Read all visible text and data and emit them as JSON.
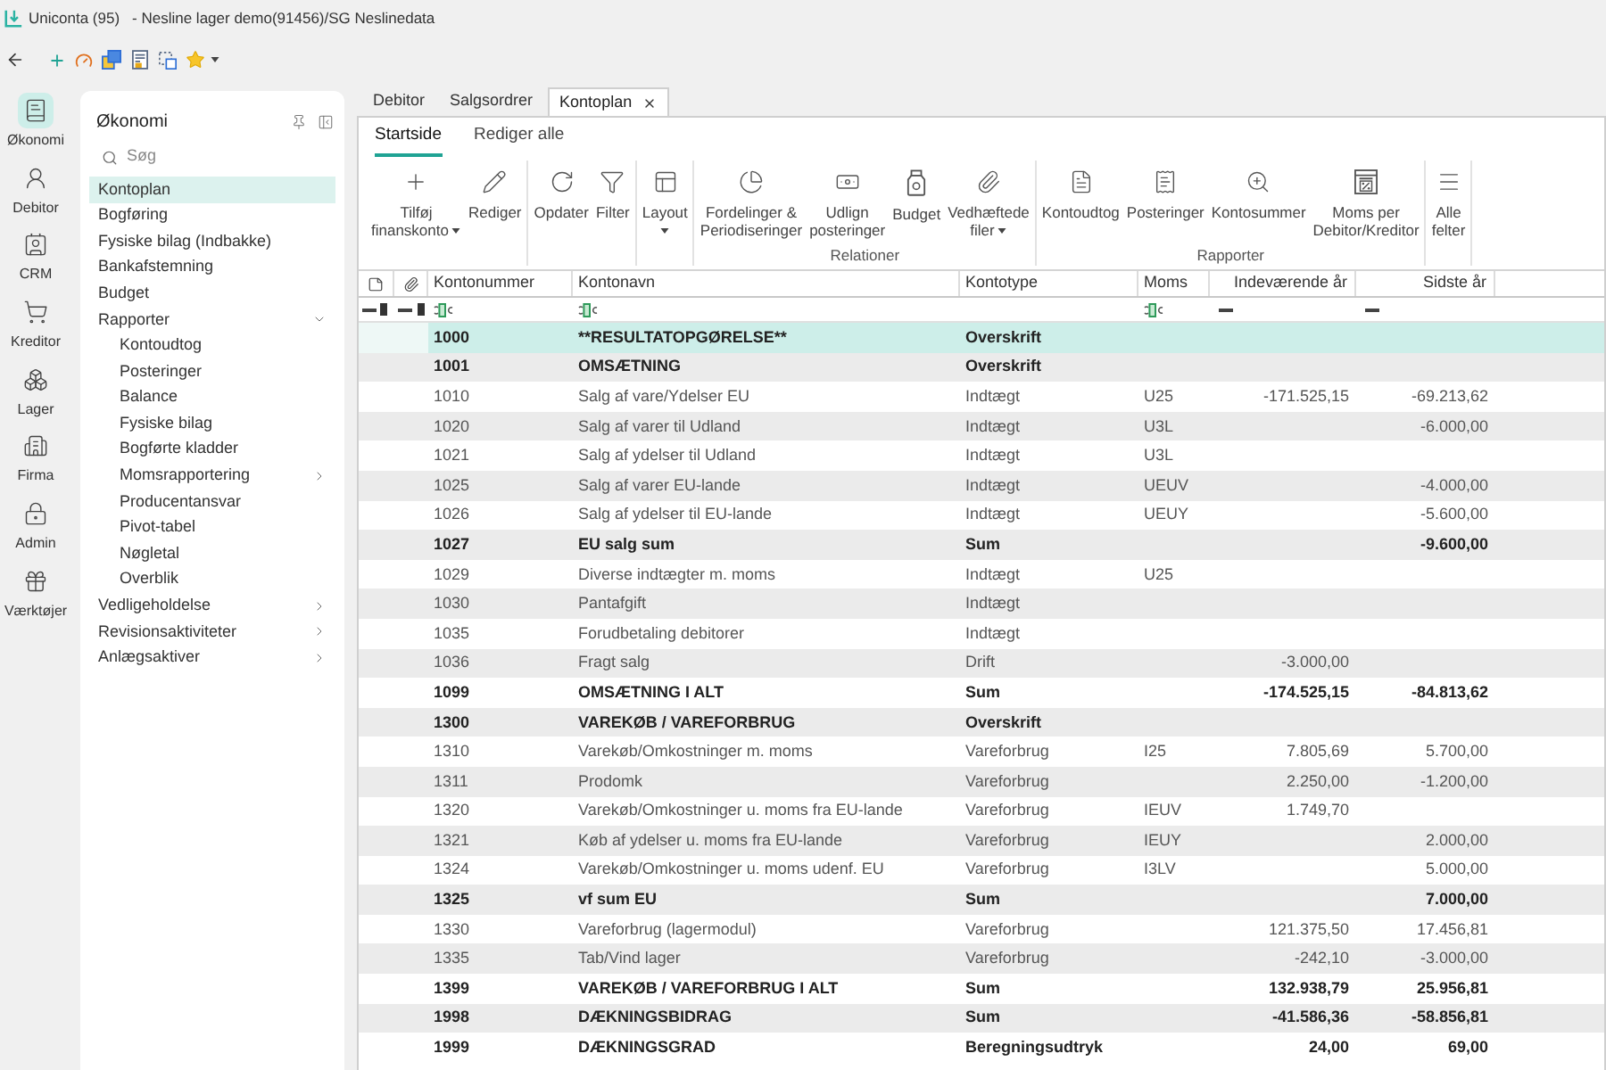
{
  "window": {
    "app": "Uniconta (95)",
    "document": "- Nesline lager demo(91456)/SG Neslinedata"
  },
  "rail": [
    {
      "label": "Økonomi",
      "selected": true
    },
    {
      "label": "Debitor",
      "selected": false
    },
    {
      "label": "CRM",
      "selected": false
    },
    {
      "label": "Kreditor",
      "selected": false
    },
    {
      "label": "Lager",
      "selected": false
    },
    {
      "label": "Firma",
      "selected": false
    },
    {
      "label": "Admin",
      "selected": false
    },
    {
      "label": "Værktøjer",
      "selected": false
    }
  ],
  "sidebar": {
    "title": "Økonomi",
    "search": {
      "placeholder": "Søg"
    },
    "items": [
      {
        "label": "Kontoplan",
        "selected": true
      },
      {
        "label": "Bogføring",
        "selected": false
      },
      {
        "label": "Fysiske bilag (Indbakke)",
        "selected": false
      },
      {
        "label": "Bankafstemning",
        "selected": false
      },
      {
        "label": "Budget",
        "selected": false
      },
      {
        "label": "Rapporter",
        "selected": false,
        "expanded": true,
        "children": [
          {
            "label": "Kontoudtog",
            "selected": false
          },
          {
            "label": "Posteringer",
            "selected": false
          },
          {
            "label": "Balance",
            "selected": false
          },
          {
            "label": "Fysiske bilag",
            "selected": false
          },
          {
            "label": "Bogførte kladder",
            "selected": false
          },
          {
            "label": "Momsrapportering",
            "selected": false,
            "expanded": false
          },
          {
            "label": "Producentansvar",
            "selected": false
          },
          {
            "label": "Pivot-tabel",
            "selected": false
          },
          {
            "label": "Nøgletal",
            "selected": false
          },
          {
            "label": "Overblik",
            "selected": false
          }
        ]
      },
      {
        "label": "Vedligeholdelse",
        "selected": false,
        "expanded": false
      },
      {
        "label": "Revisionsaktiviteter",
        "selected": false,
        "expanded": false
      },
      {
        "label": "Anlægsaktiver",
        "selected": false,
        "expanded": false
      }
    ]
  },
  "document_tabs": [
    {
      "label": "Debitor",
      "selected": false,
      "closable": false
    },
    {
      "label": "Salgsordrer",
      "selected": false,
      "closable": false
    },
    {
      "label": "Kontoplan",
      "selected": true,
      "closable": true
    }
  ],
  "ribbon": {
    "tabs": [
      {
        "label": "Startside",
        "selected": true
      },
      {
        "label": "Rediger alle",
        "selected": false
      }
    ],
    "groups": [
      {
        "buttons": [
          {
            "label": [
              "Tilføj",
              "finanskonto"
            ],
            "dropdown": true
          },
          {
            "label": [
              "Rediger"
            ],
            "dropdown": false
          }
        ]
      },
      {
        "buttons": [
          {
            "label": [
              "Opdater"
            ],
            "dropdown": false
          },
          {
            "label": [
              "Filter"
            ],
            "dropdown": false
          }
        ]
      },
      {
        "buttons": [
          {
            "label": [
              "Layout"
            ],
            "dropdown": true
          }
        ]
      },
      {
        "label": "Relationer",
        "buttons": [
          {
            "label": [
              "Fordelinger &",
              "Periodiseringer"
            ],
            "dropdown": false
          },
          {
            "label": [
              "Udlign",
              "posteringer"
            ],
            "dropdown": false
          },
          {
            "label": [
              "Budget"
            ],
            "dropdown": false
          },
          {
            "label": [
              "Vedhæftede",
              "filer"
            ],
            "dropdown": true
          }
        ]
      },
      {
        "label": "Rapporter",
        "buttons": [
          {
            "label": [
              "Kontoudtog"
            ],
            "dropdown": false
          },
          {
            "label": [
              "Posteringer"
            ],
            "dropdown": false
          },
          {
            "label": [
              "Kontosummer"
            ],
            "dropdown": false
          },
          {
            "label": [
              "Moms per",
              "Debitor/Kreditor"
            ],
            "dropdown": false
          }
        ]
      },
      {
        "buttons": [
          {
            "label": [
              "Alle",
              "felter"
            ],
            "dropdown": false
          }
        ]
      }
    ]
  },
  "table": {
    "columns": [
      "Kontonummer",
      "Kontonavn",
      "Kontotype",
      "Moms",
      "Indeværende år",
      "Sidste år"
    ],
    "rows": [
      {
        "number": "1000",
        "name": "**RESULTATOPGØRELSE**",
        "type": "Overskrift",
        "kind": "heading",
        "selected": true
      },
      {
        "number": "1001",
        "name": "OMSÆTNING",
        "type": "Overskrift",
        "kind": "heading",
        "selected": false
      },
      {
        "number": "1010",
        "name": "Salg af vare/Ydelser EU",
        "type": "Indtægt",
        "moms": "U25",
        "current": "-171.525,15",
        "last": "-69.213,62",
        "kind": "account",
        "selected": false
      },
      {
        "number": "1020",
        "name": "Salg af varer til Udland",
        "type": "Indtægt",
        "moms": "U3L",
        "last": "-6.000,00",
        "kind": "account",
        "selected": false
      },
      {
        "number": "1021",
        "name": "Salg af ydelser til Udland",
        "type": "Indtægt",
        "moms": "U3L",
        "kind": "account",
        "selected": false
      },
      {
        "number": "1025",
        "name": "Salg af varer EU-lande",
        "type": "Indtægt",
        "moms": "UEUV",
        "last": "-4.000,00",
        "kind": "account",
        "selected": false
      },
      {
        "number": "1026",
        "name": "Salg af ydelser til EU-lande",
        "type": "Indtægt",
        "moms": "UEUY",
        "last": "-5.600,00",
        "kind": "account",
        "selected": false
      },
      {
        "number": "1027",
        "name": "EU salg sum",
        "type": "Sum",
        "last": "-9.600,00",
        "kind": "sum",
        "selected": false
      },
      {
        "number": "1029",
        "name": "Diverse indtægter m. moms",
        "type": "Indtægt",
        "moms": "U25",
        "kind": "account",
        "selected": false
      },
      {
        "number": "1030",
        "name": "Pantafgift",
        "type": "Indtægt",
        "kind": "account",
        "selected": false
      },
      {
        "number": "1035",
        "name": "Forudbetaling debitorer",
        "type": "Indtægt",
        "kind": "account",
        "selected": false
      },
      {
        "number": "1036",
        "name": "Fragt salg",
        "type": "Drift",
        "current": "-3.000,00",
        "kind": "account",
        "selected": false
      },
      {
        "number": "1099",
        "name": "OMSÆTNING I ALT",
        "type": "Sum",
        "current": "-174.525,15",
        "last": "-84.813,62",
        "kind": "sum",
        "selected": false
      },
      {
        "number": "1300",
        "name": "VAREKØB / VAREFORBRUG",
        "type": "Overskrift",
        "kind": "heading",
        "selected": false
      },
      {
        "number": "1310",
        "name": "Varekøb/Omkostninger m. moms",
        "type": "Vareforbrug",
        "moms": "I25",
        "current": "7.805,69",
        "last": "5.700,00",
        "kind": "account",
        "selected": false
      },
      {
        "number": "1311",
        "name": "Prodomk",
        "type": "Vareforbrug",
        "current": "2.250,00",
        "last": "-1.200,00",
        "kind": "account",
        "selected": false
      },
      {
        "number": "1320",
        "name": "Varekøb/Omkostninger u. moms fra EU-lande",
        "type": "Vareforbrug",
        "moms": "IEUV",
        "current": "1.749,70",
        "kind": "account",
        "selected": false
      },
      {
        "number": "1321",
        "name": "Køb af ydelser u. moms fra EU-lande",
        "type": "Vareforbrug",
        "moms": "IEUY",
        "last": "2.000,00",
        "kind": "account",
        "selected": false
      },
      {
        "number": "1324",
        "name": "Varekøb/Omkostninger u. moms udenf. EU",
        "type": "Vareforbrug",
        "moms": "I3LV",
        "last": "5.000,00",
        "kind": "account",
        "selected": false
      },
      {
        "number": "1325",
        "name": "vf sum EU",
        "type": "Sum",
        "last": "7.000,00",
        "kind": "sum",
        "selected": false
      },
      {
        "number": "1330",
        "name": "Vareforbrug (lagermodul)",
        "type": "Vareforbrug",
        "current": "121.375,50",
        "last": "17.456,81",
        "kind": "account",
        "selected": false
      },
      {
        "number": "1335",
        "name": "Tab/Vind lager",
        "type": "Vareforbrug",
        "current": "-242,10",
        "last": "-3.000,00",
        "kind": "account",
        "selected": false
      },
      {
        "number": "1399",
        "name": "VAREKØB / VAREFORBRUG I ALT",
        "type": "Sum",
        "current": "132.938,79",
        "last": "25.956,81",
        "kind": "sum",
        "selected": false
      },
      {
        "number": "1998",
        "name": "DÆKNINGSBIDRAG",
        "type": "Sum",
        "current": "-41.586,36",
        "last": "-58.856,81",
        "kind": "sum",
        "selected": false
      },
      {
        "number": "1999",
        "name": "DÆKNINGSGRAD",
        "type": "Beregningsudtryk",
        "current": "24,00",
        "last": "69,00",
        "kind": "formula",
        "selected": false
      }
    ]
  }
}
